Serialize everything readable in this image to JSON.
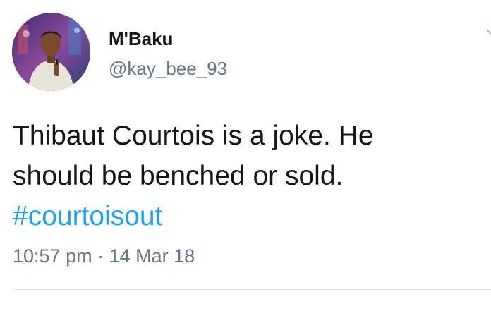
{
  "user": {
    "display_name": "M'Baku",
    "handle": "@kay_bee_93"
  },
  "tweet": {
    "line1": "Thibaut Courtois is a joke. He",
    "line2": "should be benched or sold.",
    "hashtag": "#courtoisout",
    "time": "10:57 pm",
    "separator": "·",
    "date": "14 Mar 18"
  },
  "icons": {
    "avatar": "avatar-photo",
    "menu": "chevron-down-icon"
  },
  "colors": {
    "link": "#1da1f2",
    "secondary_text": "#657786",
    "primary_text": "#14171a"
  }
}
